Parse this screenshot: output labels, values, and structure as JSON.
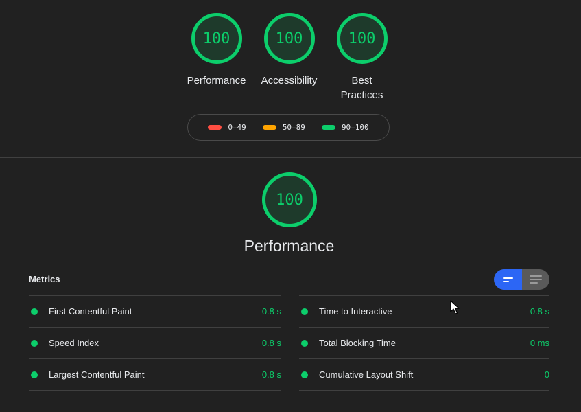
{
  "summary": {
    "gauges": [
      {
        "score": "100",
        "label": "Performance"
      },
      {
        "score": "100",
        "label": "Accessibility"
      },
      {
        "score": "100",
        "label": "Best Practices"
      }
    ]
  },
  "legend": [
    {
      "text": "0–49",
      "color": "#ff4e42"
    },
    {
      "text": "50–89",
      "color": "#ffa400"
    },
    {
      "text": "90–100",
      "color": "#0cce6b"
    }
  ],
  "category": {
    "score": "100",
    "title": "Performance"
  },
  "metrics": {
    "title": "Metrics",
    "left": [
      {
        "name": "First Contentful Paint",
        "value": "0.8 s"
      },
      {
        "name": "Speed Index",
        "value": "0.8 s"
      },
      {
        "name": "Largest Contentful Paint",
        "value": "0.8 s"
      }
    ],
    "right": [
      {
        "name": "Time to Interactive",
        "value": "0.8 s"
      },
      {
        "name": "Total Blocking Time",
        "value": "0 ms"
      },
      {
        "name": "Cumulative Layout Shift",
        "value": "0"
      }
    ]
  },
  "colors": {
    "pass": "#0cce6b",
    "toggle_active": "#2c66f5",
    "background": "#212121"
  },
  "icons": {
    "toggle_compact": "collapsed-view-icon",
    "toggle_expanded": "expanded-view-icon",
    "cursor": "mouse-pointer-icon"
  }
}
